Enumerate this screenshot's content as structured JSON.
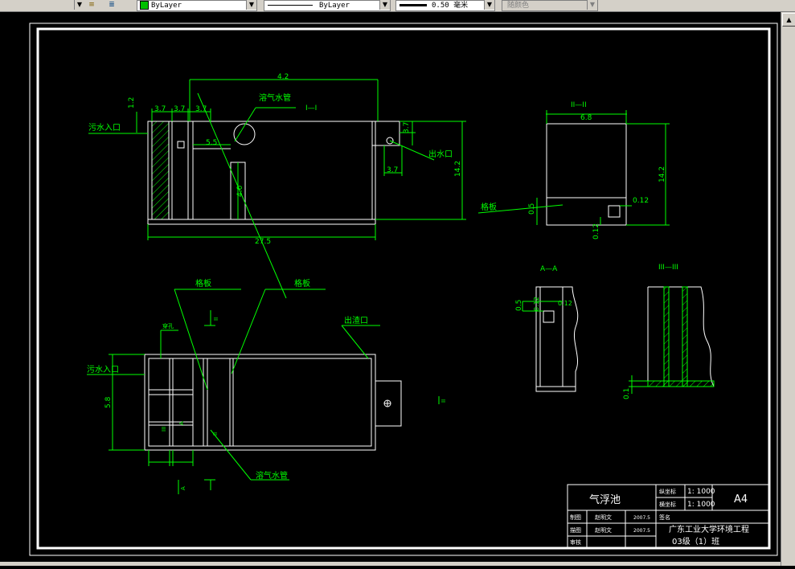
{
  "toolbar": {
    "color_control": "ByLayer",
    "linetype_control": "ByLayer",
    "lineweight_control": "0.50 毫米",
    "plotstyle_control": "随颜色"
  },
  "colors": {
    "background": "#000000",
    "frame": "#ffffff",
    "geometry": "#ffffff",
    "annotation": "#00ff00",
    "hatch": "#00ff00"
  },
  "drawing": {
    "front_view": {
      "section_label": "I—I",
      "dims": {
        "top_width": "4.2",
        "inlet_height": "1.2",
        "seg1": "3.7",
        "seg2": "3.7",
        "seg3": "3.7",
        "inner_width": "5.5",
        "baffle_height": "4.0",
        "outlet_height": "3.7",
        "outlet_width": "3.7",
        "total_height": "14.2",
        "total_length": "27.5"
      },
      "labels": {
        "inlet": "污水入口",
        "dissolved_air_pipe": "溶气水管",
        "outlet": "出水口"
      }
    },
    "side_view": {
      "section_label": "II—II",
      "dims": {
        "width": "6.8",
        "height": "14.2",
        "gap": "0.5",
        "plate": "0.12",
        "base": "0.12"
      },
      "labels": {
        "baffle": "格板"
      }
    },
    "plan_view": {
      "labels": {
        "baffle_left": "格板",
        "baffle_right": "格板",
        "inlet": "污水入口",
        "scum_outlet": "出渣口",
        "dissolved_air_pipe": "溶气水管",
        "small_label": "穿孔"
      },
      "dims": {
        "width": "5.8"
      },
      "section_marks": [
        "II",
        "III",
        "A",
        "II",
        "A",
        "II"
      ]
    },
    "section_aa": {
      "title": "A—A",
      "dims": {
        "a": "0.5",
        "b": "0.12",
        "c": "0.12"
      }
    },
    "section_iii": {
      "title": "III—III",
      "dims": {
        "base": "0.1"
      }
    },
    "title_block": {
      "drawing_name": "气浮池",
      "scale_h_label": "纵坐标",
      "scale_h_value": "1: 1000",
      "scale_v_label": "横坐标",
      "scale_v_value": "1: 1000",
      "sheet_size": "A4",
      "row1_role": "制图",
      "row1_name": "赵明文",
      "row1_date": "2007.5",
      "row1_extra": "签名",
      "row2_role": "描图",
      "row2_name": "赵明文",
      "row2_date": "2007.5",
      "row3_role": "审核",
      "school_line1": "广东工业大学环境工程",
      "school_line2": "03级（1）班"
    }
  }
}
